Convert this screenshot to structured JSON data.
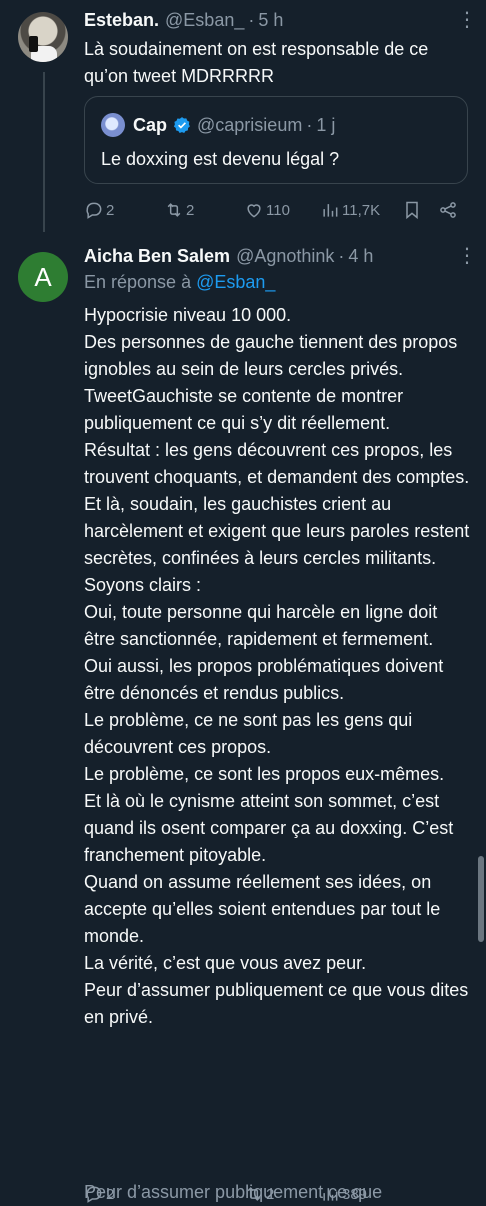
{
  "tweets": [
    {
      "name": "Esteban.",
      "handle": "@Esban_",
      "time": "5 h",
      "text": "Là soudainement on est responsable de ce qu’on tweet MDRRRRR",
      "quote": {
        "name": "Cap",
        "handle": "@caprisieum",
        "time": "1 j",
        "text": "Le doxxing est devenu légal ?"
      },
      "actions": {
        "replies": "2",
        "retweets": "2",
        "likes": "110",
        "views": "11,7K"
      }
    },
    {
      "avatar_letter": "A",
      "name": "Aicha Ben Salem",
      "handle": "@Agnothink",
      "time": "4 h",
      "reply_prefix": "En réponse à",
      "reply_mention": "@Esban_",
      "text": "Hypocrisie niveau 10 000.\nDes personnes de gauche tiennent des propos ignobles au sein de leurs cercles privés. TweetGauchiste se contente de montrer publiquement ce qui s’y dit réellement.\nRésultat : les gens découvrent ces propos, les trouvent choquants, et demandent des comptes.\nEt là, soudain, les gauchistes crient au harcèlement et exigent que leurs paroles restent secrètes, confinées à leurs cercles militants.\nSoyons clairs :\nOui, toute personne qui harcèle en ligne doit être sanctionnée, rapidement et fermement.\nOui aussi, les propos problématiques doivent être dénoncés et rendus publics.\nLe problème, ce ne sont pas les gens qui découvrent ces propos.\nLe problème, ce sont les propos eux-mêmes.\nEt là où le cynisme atteint son sommet, c’est quand ils osent comparer ça au doxxing. C’est franchement pitoyable.\nQuand on assume réellement ses idées, on accepte qu’elles soient entendues par tout le monde.\nLa vérité, c’est que vous avez peur.\nPeur d’assumer publiquement ce que vous dites en privé.",
      "actions": {
        "replies": "2",
        "retweets": "2",
        "views": "389"
      },
      "overlay_text": "Peur d’assumer publiquement ce que"
    }
  ],
  "colors": {
    "background": "#15202b",
    "text": "#f7f9f9",
    "muted": "#8b98a5",
    "accent": "#1d9bf0",
    "avatar_green": "#2e7d32",
    "border": "#38444d"
  },
  "icons": [
    "reply-icon",
    "retweet-icon",
    "like-icon",
    "views-icon",
    "bookmark-icon",
    "share-icon",
    "more-icon",
    "verified-icon"
  ]
}
